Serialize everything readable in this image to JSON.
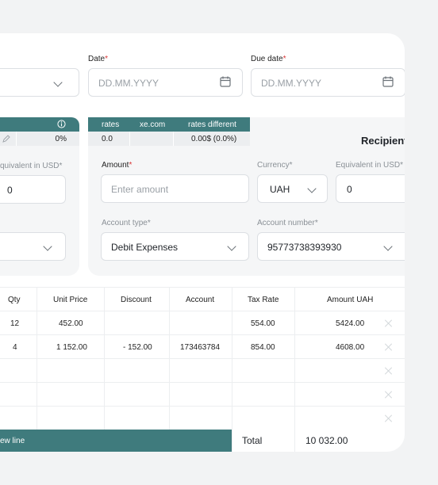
{
  "header_fields": {
    "date": {
      "label": "Date",
      "required": "*",
      "placeholder": "DD.MM.YYYY"
    },
    "due_date": {
      "label": "Due date",
      "required": "*",
      "placeholder": "DD.MM.YYYY"
    }
  },
  "left_panel": {
    "fx_value": "0%",
    "equiv_label": "quivalent in USD*",
    "equiv_value": "0"
  },
  "rates_table": {
    "headers": [
      "rates",
      "xe.com",
      "rates different"
    ],
    "values": [
      "0.0",
      "",
      "0.00$ (0.0%)"
    ]
  },
  "recipient": {
    "title": "Recipient",
    "amount": {
      "label": "Amount",
      "required": "*",
      "placeholder": "Enter amount"
    },
    "currency": {
      "label": "Currency*",
      "value": "UAH"
    },
    "equiv": {
      "label": "Equivalent in USD*",
      "value": "0"
    },
    "account_type": {
      "label": "Account type*",
      "value": "Debit Expenses"
    },
    "account_number": {
      "label": "Account number*",
      "value": "95773738393930"
    }
  },
  "table": {
    "headers": {
      "qty": "Qty",
      "unit_price": "Unit Price",
      "discount": "Discount",
      "account": "Account",
      "tax_rate": "Tax Rate",
      "amount": "Amount UAH"
    },
    "rows": [
      {
        "qty": "12",
        "unit_price": "452.00",
        "discount": "",
        "account": "",
        "tax_rate": "554.00",
        "amount": "5424.00"
      },
      {
        "qty": "4",
        "unit_price": "1 152.00",
        "discount": "- 152.00",
        "account": "173463784",
        "tax_rate": "854.00",
        "amount": "4608.00"
      }
    ],
    "add_line_label": "ew line",
    "total_label": "Total",
    "total_value": "10 032.00"
  },
  "colors": {
    "accent": "#3f7b7d",
    "required": "#d93636"
  }
}
